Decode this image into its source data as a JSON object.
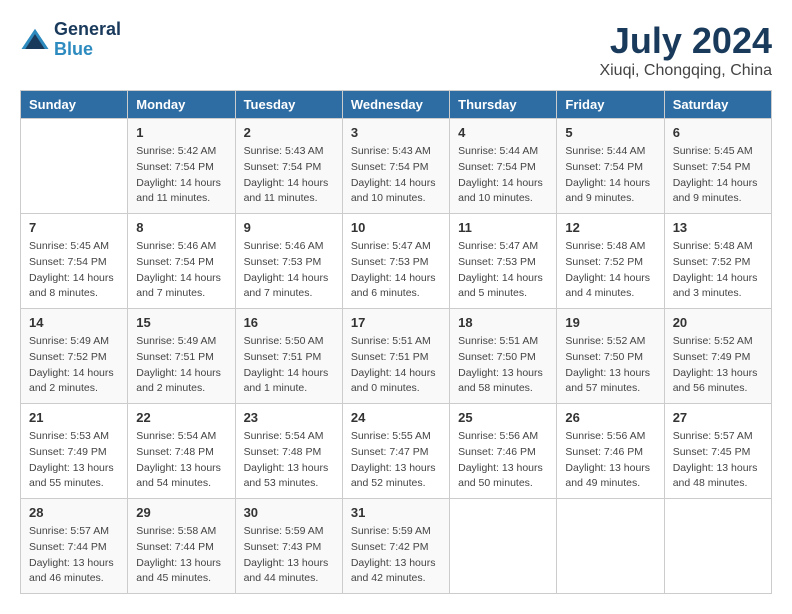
{
  "logo": {
    "line1": "General",
    "line2": "Blue"
  },
  "title": "July 2024",
  "subtitle": "Xiuqi, Chongqing, China",
  "days_of_week": [
    "Sunday",
    "Monday",
    "Tuesday",
    "Wednesday",
    "Thursday",
    "Friday",
    "Saturday"
  ],
  "weeks": [
    [
      {
        "day": "",
        "info": ""
      },
      {
        "day": "1",
        "info": "Sunrise: 5:42 AM\nSunset: 7:54 PM\nDaylight: 14 hours\nand 11 minutes."
      },
      {
        "day": "2",
        "info": "Sunrise: 5:43 AM\nSunset: 7:54 PM\nDaylight: 14 hours\nand 11 minutes."
      },
      {
        "day": "3",
        "info": "Sunrise: 5:43 AM\nSunset: 7:54 PM\nDaylight: 14 hours\nand 10 minutes."
      },
      {
        "day": "4",
        "info": "Sunrise: 5:44 AM\nSunset: 7:54 PM\nDaylight: 14 hours\nand 10 minutes."
      },
      {
        "day": "5",
        "info": "Sunrise: 5:44 AM\nSunset: 7:54 PM\nDaylight: 14 hours\nand 9 minutes."
      },
      {
        "day": "6",
        "info": "Sunrise: 5:45 AM\nSunset: 7:54 PM\nDaylight: 14 hours\nand 9 minutes."
      }
    ],
    [
      {
        "day": "7",
        "info": "Sunrise: 5:45 AM\nSunset: 7:54 PM\nDaylight: 14 hours\nand 8 minutes."
      },
      {
        "day": "8",
        "info": "Sunrise: 5:46 AM\nSunset: 7:54 PM\nDaylight: 14 hours\nand 7 minutes."
      },
      {
        "day": "9",
        "info": "Sunrise: 5:46 AM\nSunset: 7:53 PM\nDaylight: 14 hours\nand 7 minutes."
      },
      {
        "day": "10",
        "info": "Sunrise: 5:47 AM\nSunset: 7:53 PM\nDaylight: 14 hours\nand 6 minutes."
      },
      {
        "day": "11",
        "info": "Sunrise: 5:47 AM\nSunset: 7:53 PM\nDaylight: 14 hours\nand 5 minutes."
      },
      {
        "day": "12",
        "info": "Sunrise: 5:48 AM\nSunset: 7:52 PM\nDaylight: 14 hours\nand 4 minutes."
      },
      {
        "day": "13",
        "info": "Sunrise: 5:48 AM\nSunset: 7:52 PM\nDaylight: 14 hours\nand 3 minutes."
      }
    ],
    [
      {
        "day": "14",
        "info": "Sunrise: 5:49 AM\nSunset: 7:52 PM\nDaylight: 14 hours\nand 2 minutes."
      },
      {
        "day": "15",
        "info": "Sunrise: 5:49 AM\nSunset: 7:51 PM\nDaylight: 14 hours\nand 2 minutes."
      },
      {
        "day": "16",
        "info": "Sunrise: 5:50 AM\nSunset: 7:51 PM\nDaylight: 14 hours\nand 1 minute."
      },
      {
        "day": "17",
        "info": "Sunrise: 5:51 AM\nSunset: 7:51 PM\nDaylight: 14 hours\nand 0 minutes."
      },
      {
        "day": "18",
        "info": "Sunrise: 5:51 AM\nSunset: 7:50 PM\nDaylight: 13 hours\nand 58 minutes."
      },
      {
        "day": "19",
        "info": "Sunrise: 5:52 AM\nSunset: 7:50 PM\nDaylight: 13 hours\nand 57 minutes."
      },
      {
        "day": "20",
        "info": "Sunrise: 5:52 AM\nSunset: 7:49 PM\nDaylight: 13 hours\nand 56 minutes."
      }
    ],
    [
      {
        "day": "21",
        "info": "Sunrise: 5:53 AM\nSunset: 7:49 PM\nDaylight: 13 hours\nand 55 minutes."
      },
      {
        "day": "22",
        "info": "Sunrise: 5:54 AM\nSunset: 7:48 PM\nDaylight: 13 hours\nand 54 minutes."
      },
      {
        "day": "23",
        "info": "Sunrise: 5:54 AM\nSunset: 7:48 PM\nDaylight: 13 hours\nand 53 minutes."
      },
      {
        "day": "24",
        "info": "Sunrise: 5:55 AM\nSunset: 7:47 PM\nDaylight: 13 hours\nand 52 minutes."
      },
      {
        "day": "25",
        "info": "Sunrise: 5:56 AM\nSunset: 7:46 PM\nDaylight: 13 hours\nand 50 minutes."
      },
      {
        "day": "26",
        "info": "Sunrise: 5:56 AM\nSunset: 7:46 PM\nDaylight: 13 hours\nand 49 minutes."
      },
      {
        "day": "27",
        "info": "Sunrise: 5:57 AM\nSunset: 7:45 PM\nDaylight: 13 hours\nand 48 minutes."
      }
    ],
    [
      {
        "day": "28",
        "info": "Sunrise: 5:57 AM\nSunset: 7:44 PM\nDaylight: 13 hours\nand 46 minutes."
      },
      {
        "day": "29",
        "info": "Sunrise: 5:58 AM\nSunset: 7:44 PM\nDaylight: 13 hours\nand 45 minutes."
      },
      {
        "day": "30",
        "info": "Sunrise: 5:59 AM\nSunset: 7:43 PM\nDaylight: 13 hours\nand 44 minutes."
      },
      {
        "day": "31",
        "info": "Sunrise: 5:59 AM\nSunset: 7:42 PM\nDaylight: 13 hours\nand 42 minutes."
      },
      {
        "day": "",
        "info": ""
      },
      {
        "day": "",
        "info": ""
      },
      {
        "day": "",
        "info": ""
      }
    ]
  ]
}
